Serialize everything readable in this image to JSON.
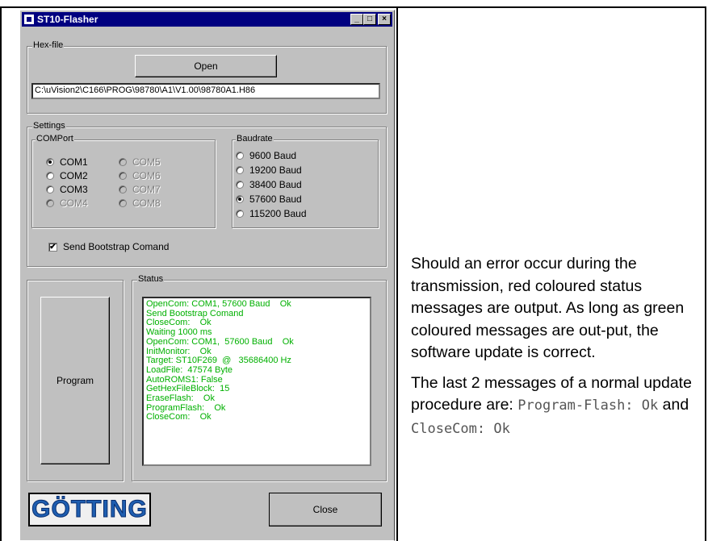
{
  "window": {
    "title": "ST10-Flasher",
    "controls": {
      "minimize": "_",
      "maximize": "□",
      "close": "×"
    }
  },
  "hexfile": {
    "group_label": "Hex-file",
    "open_label": "Open",
    "path": "C:\\uVision2\\C166\\PROG\\98780\\A1\\V1.00\\98780A1.H86"
  },
  "settings": {
    "group_label": "Settings",
    "comport": {
      "label": "COMPort",
      "ports": [
        {
          "label": "COM1",
          "selected": true,
          "enabled": true
        },
        {
          "label": "COM2",
          "selected": false,
          "enabled": true
        },
        {
          "label": "COM3",
          "selected": false,
          "enabled": true
        },
        {
          "label": "COM4",
          "selected": false,
          "enabled": false
        },
        {
          "label": "COM5",
          "selected": false,
          "enabled": false
        },
        {
          "label": "COM6",
          "selected": false,
          "enabled": false
        },
        {
          "label": "COM7",
          "selected": false,
          "enabled": false
        },
        {
          "label": "COM8",
          "selected": false,
          "enabled": false
        }
      ]
    },
    "baudrate": {
      "label": "Baudrate",
      "options": [
        {
          "label": "9600 Baud",
          "selected": false
        },
        {
          "label": "19200 Baud",
          "selected": false
        },
        {
          "label": "38400 Baud",
          "selected": false
        },
        {
          "label": "57600 Baud",
          "selected": true
        },
        {
          "label": "115200 Baud",
          "selected": false
        }
      ]
    },
    "bootstrap": {
      "label": "Send Bootstrap Comand",
      "checked": true,
      "mark": "✔"
    }
  },
  "program_label": "Program",
  "status": {
    "label": "Status",
    "lines": [
      "OpenCom: COM1, 57600 Baud    Ok",
      "Send Bootstrap Comand",
      "CloseCom:    Ok",
      "Waiting 1000 ms",
      "OpenCom: COM1,  57600 Baud    Ok",
      "InitMonitor:    Ok",
      "Target: ST10F269  @   35686400 Hz",
      "LoadFile:  47574 Byte",
      "AutoROMS1: False",
      "GetHexFileBlock:  15",
      "EraseFlash:    Ok",
      "ProgramFlash:    Ok",
      "CloseCom:    Ok"
    ],
    "color": "#00b000"
  },
  "logo_text": "GÖTTING",
  "close_label": "Close",
  "side_text": {
    "para1": "Should an error occur during the transmission, red coloured status messages are output. As long as green coloured messages are out-put, the software update is correct.",
    "para2_prefix": "The last 2 messages of a normal update procedure are: ",
    "code1": "Program-Flash: Ok",
    "connector": " and ",
    "code2": "CloseCom: Ok"
  }
}
